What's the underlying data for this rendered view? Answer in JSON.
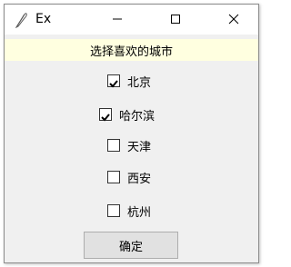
{
  "window": {
    "title": "Ex",
    "app_icon": "feather-icon",
    "controls": [
      "minimize-icon",
      "maximize-icon",
      "close-icon"
    ]
  },
  "prompt_label": "选择喜欢的城市",
  "cities": [
    {
      "label": "北京",
      "checked": true
    },
    {
      "label": "哈尔滨",
      "checked": true
    },
    {
      "label": "天津",
      "checked": false
    },
    {
      "label": "西安",
      "checked": false
    },
    {
      "label": "杭州",
      "checked": false
    }
  ],
  "confirm_button_label": "确定",
  "colors": {
    "window_bg": "#f0f0f0",
    "label_bg": "#ffffe0",
    "titlebar_bg": "#ffffff",
    "button_bg": "#e1e1e1"
  }
}
